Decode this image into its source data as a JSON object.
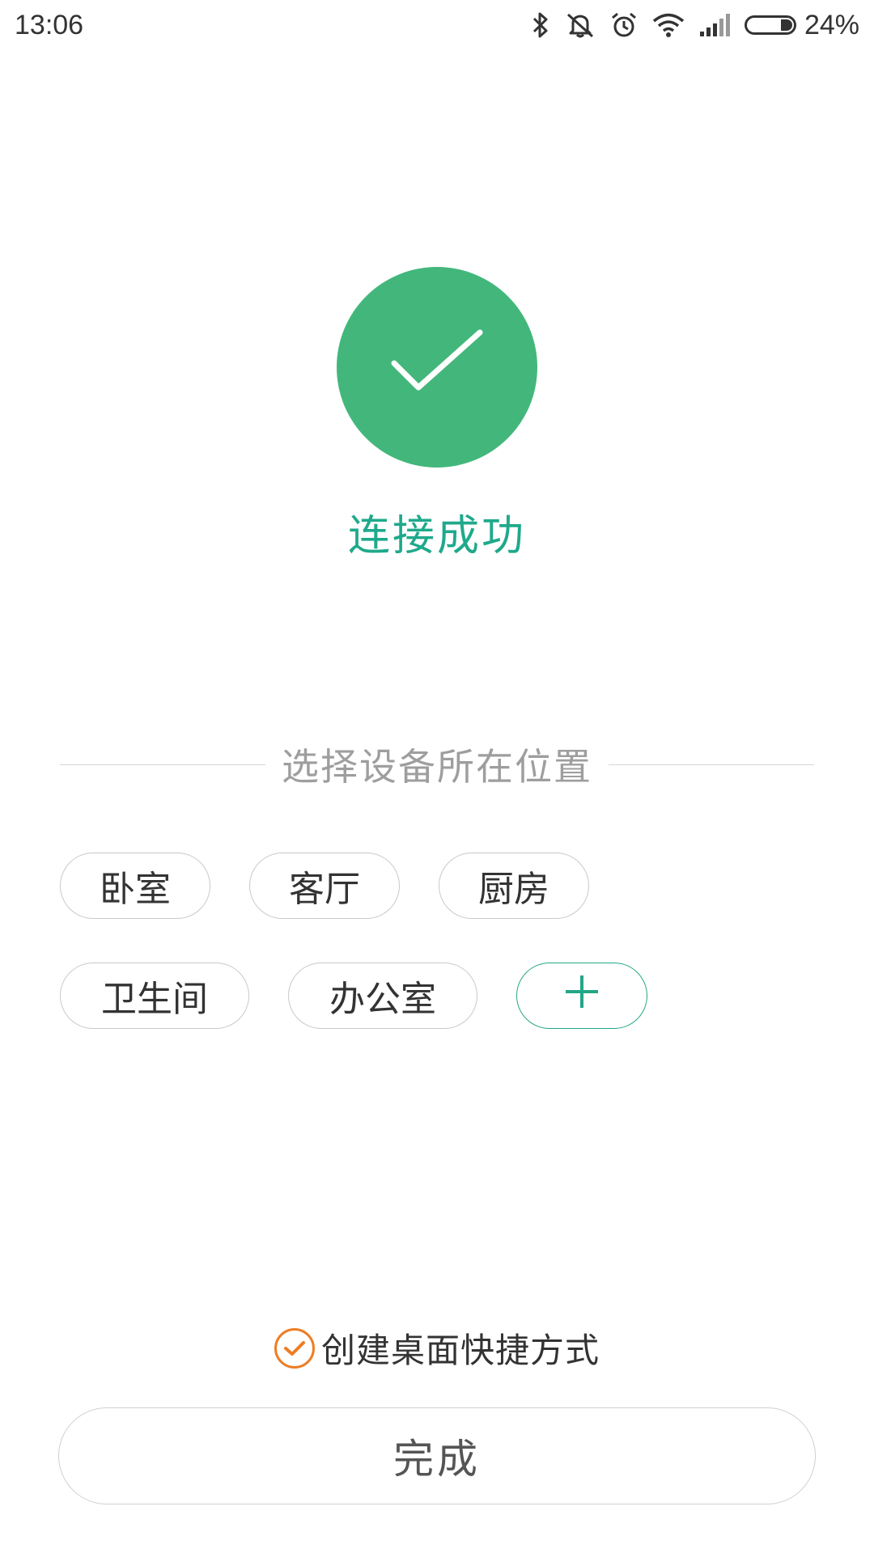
{
  "status_bar": {
    "time": "13:06",
    "icons": [
      "bluetooth-icon",
      "mute-icon",
      "alarm-icon",
      "wifi-icon",
      "signal-icon",
      "battery-icon"
    ],
    "battery_percent": "24%",
    "battery_level": 0.24
  },
  "success": {
    "icon": "check-icon",
    "title": "连接成功",
    "color": "#43b77b",
    "title_color": "#1fa98b"
  },
  "location": {
    "heading": "选择设备所在位置",
    "rooms_row1": [
      "卧室",
      "客厅",
      "厨房"
    ],
    "rooms_row2": [
      "卫生间",
      "办公室"
    ],
    "add_icon": "plus-icon"
  },
  "shortcut": {
    "checked": true,
    "label": "创建桌面快捷方式",
    "accent": "#ee7d24"
  },
  "done_button": {
    "label": "完成"
  }
}
